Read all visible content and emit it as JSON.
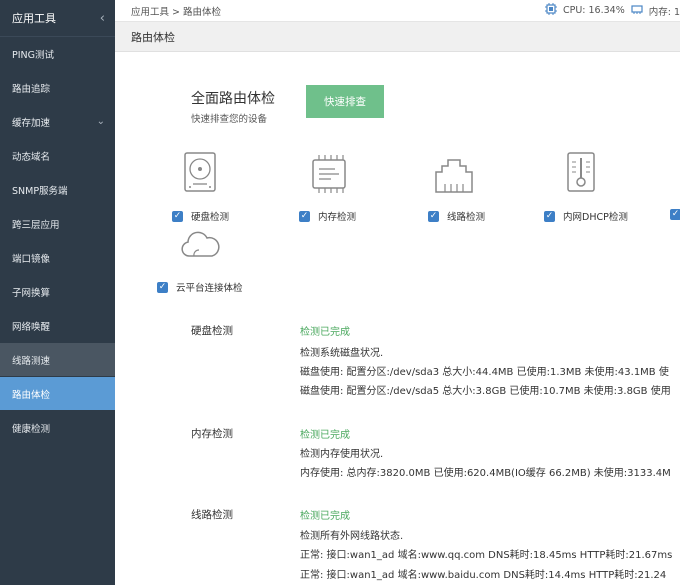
{
  "sidebar": {
    "title": "应用工具",
    "items": [
      {
        "label": "PING测试"
      },
      {
        "label": "路由追踪"
      },
      {
        "label": "缓存加速"
      },
      {
        "label": "动态域名"
      },
      {
        "label": "SNMP服务端"
      },
      {
        "label": "跨三层应用"
      },
      {
        "label": "端口镜像"
      },
      {
        "label": "子网换算"
      },
      {
        "label": "网络唤醒"
      },
      {
        "label": "线路测速"
      },
      {
        "label": "路由体检"
      },
      {
        "label": "健康检测"
      }
    ]
  },
  "topbar": {
    "breadcrumb": "应用工具 > 路由体检",
    "cpu": "CPU: 16.34%",
    "mem": "内存: 1"
  },
  "page": {
    "title": "路由体检"
  },
  "hero": {
    "title": "全面路由体检",
    "subtitle": "快速排查您的设备",
    "button": "快速排查"
  },
  "checks": [
    {
      "label": "硬盘检测",
      "icon": "hard-disk-icon",
      "checked": true
    },
    {
      "label": "内存检测",
      "icon": "memory-chip-icon",
      "checked": true
    },
    {
      "label": "线路检测",
      "icon": "network-port-icon",
      "checked": true
    },
    {
      "label": "内网DHCP检测",
      "icon": "dhcp-thermometer-icon",
      "checked": true
    },
    {
      "label": "云平台连接体检",
      "icon": "cloud-icon",
      "checked": true
    }
  ],
  "results": [
    {
      "label": "硬盘检测",
      "status": "检测已完成",
      "lines": [
        "检测系统磁盘状况.",
        "磁盘使用: 配置分区:/dev/sda3 总大小:44.4MB 已使用:1.3MB 未使用:43.1MB 使",
        "磁盘使用: 配置分区:/dev/sda5 总大小:3.8GB 已使用:10.7MB 未使用:3.8GB 使用"
      ]
    },
    {
      "label": "内存检测",
      "status": "检测已完成",
      "lines": [
        "检测内存使用状况.",
        "内存使用: 总内存:3820.0MB 已使用:620.4MB(IO缓存 66.2MB) 未使用:3133.4M"
      ]
    },
    {
      "label": "线路检测",
      "status": "检测已完成",
      "lines": [
        "检测所有外网线路状态.",
        "正常: 接口:wan1_ad 域名:www.qq.com DNS耗时:18.45ms HTTP耗时:21.67ms",
        "正常: 接口:wan1_ad 域名:www.baidu.com DNS耗时:14.4ms HTTP耗时:21.24"
      ]
    }
  ],
  "colors": {
    "sidebar_bg": "#2e3b48",
    "active": "#5b9bd5",
    "accent_green": "#6fc08b",
    "status_green": "#4aa85e",
    "checkbox": "#3d7fc6"
  }
}
